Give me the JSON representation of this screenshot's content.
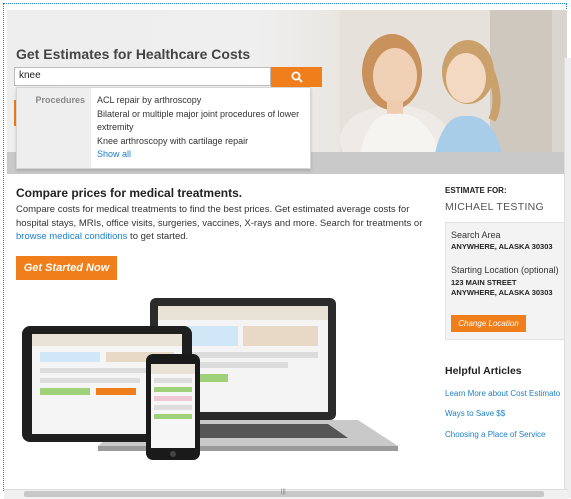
{
  "hero": {
    "title": "Get Estimates for Healthcare Costs",
    "search_value": "knee"
  },
  "dropdown": {
    "category": "Procedures",
    "items": [
      "ACL repair by arthroscopy",
      "Bilateral or multiple major joint procedures of lower extremity",
      "Knee arthroscopy with cartilage repair"
    ],
    "show_all": "Show all"
  },
  "main": {
    "heading": "Compare prices for medical treatments.",
    "paragraph_before_link": "Compare costs for medical treatments to find the best prices. Get estimated average costs for hospital stays, MRIs, office visits, surgeries, vaccines, X-rays and more. Search for treatments or ",
    "link_text": "browse medical conditions",
    "paragraph_after_link": " to get started.",
    "cta_label": "Get Started Now"
  },
  "estimate": {
    "label": "ESTIMATE FOR:",
    "name": "MICHAEL TESTING",
    "search_area_title": "Search Area",
    "search_area_value": "ANYWHERE, ALASKA 30303",
    "start_title": "Starting Location (optional)",
    "start_line1": "123 MAIN STREET",
    "start_line2": "ANYWHERE, ALASKA 30303",
    "change_label": "Change Location"
  },
  "articles": {
    "heading": "Helpful Articles",
    "links": [
      "Learn More about Cost Estimato",
      "Ways to Save $$",
      "Choosing a Place of Service"
    ]
  },
  "colors": {
    "accent": "#f07e1a",
    "link": "#1e7fc8"
  }
}
